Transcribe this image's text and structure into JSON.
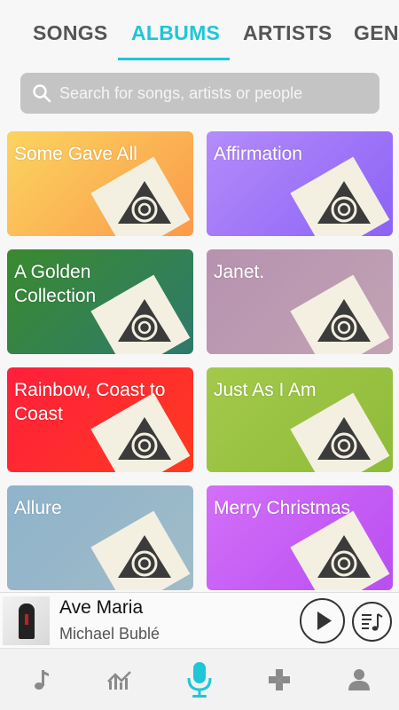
{
  "tabs": [
    {
      "label": "SONGS",
      "active": false
    },
    {
      "label": "ALBUMS",
      "active": true
    },
    {
      "label": "ARTISTS",
      "active": false
    },
    {
      "label": "GENRES",
      "active": false
    }
  ],
  "search": {
    "placeholder": "Search for songs, artists or people",
    "icon": "search-icon"
  },
  "albums": [
    {
      "title": "Some Gave All",
      "gradient": [
        "#fbd460",
        "#fb9a4a"
      ]
    },
    {
      "title": "Affirmation",
      "gradient": [
        "#b48cfa",
        "#8b62f6"
      ]
    },
    {
      "title": "A Golden Collection",
      "gradient": [
        "#3a8a2f",
        "#2e7a6c"
      ]
    },
    {
      "title": "Janet.",
      "gradient": [
        "#b792b0",
        "#c1a3b4"
      ]
    },
    {
      "title": "Rainbow, Coast to Coast",
      "gradient": [
        "#ff1f3c",
        "#ff3a20"
      ]
    },
    {
      "title": "Just As I Am",
      "gradient": [
        "#a4c94a",
        "#8fbb3a"
      ]
    },
    {
      "title": "Allure",
      "gradient": [
        "#8eb3cb",
        "#a1bcc7"
      ]
    },
    {
      "title": "Merry Christmas",
      "gradient": [
        "#d36ff8",
        "#b94ef2"
      ]
    }
  ],
  "now_playing": {
    "title": "Ave Maria",
    "artist": "Michael Bublé"
  },
  "bottom_nav": [
    {
      "icon": "music-note-icon",
      "active": false
    },
    {
      "icon": "trending-icon",
      "active": false
    },
    {
      "icon": "microphone-icon",
      "active": true
    },
    {
      "icon": "gamepad-icon",
      "active": false
    },
    {
      "icon": "profile-icon",
      "active": false
    }
  ],
  "colors": {
    "accent": "#1ec6d8",
    "tab_inactive": "#555555",
    "search_bg": "#c4c4c4"
  }
}
